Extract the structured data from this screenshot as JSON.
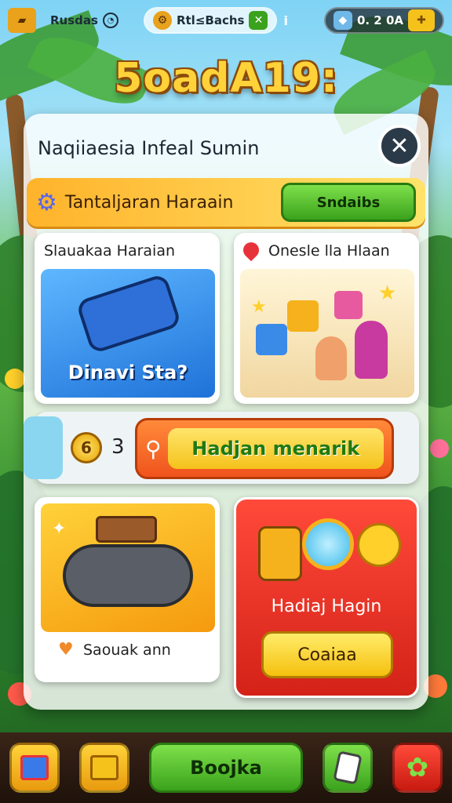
{
  "topbar": {
    "player_name": "Rusdas",
    "badge_text": "Rtl≤Bachs",
    "currency_value": "0. 2 0A"
  },
  "logo": "5oadA19:",
  "panel": {
    "title": "Naqiiaesia Infeal Sumin",
    "close_icon": "✕"
  },
  "banner": {
    "label": "Tantaljaran Haraain",
    "button_label": "Sndaibs"
  },
  "cards": {
    "left_top": {
      "label": "Slauakaa Haraian",
      "art_text": "Dinavi Sta?"
    },
    "right_top": {
      "label": "Onesle lla Hlaan"
    },
    "left_bottom": {
      "label": "Saouak ann"
    },
    "right_bottom": {
      "label": "Hadiaj Hagin",
      "button_label": "Coaiaa"
    }
  },
  "strip": {
    "coin_value": "6",
    "count": "3",
    "action_label": "Hadjan menarik"
  },
  "bottombar": {
    "center_label": "Boojka"
  },
  "colors": {
    "accent_green": "#3aa21c",
    "accent_orange": "#f0531c",
    "accent_red": "#d42218",
    "banner_yellow": "#ffb32b"
  }
}
